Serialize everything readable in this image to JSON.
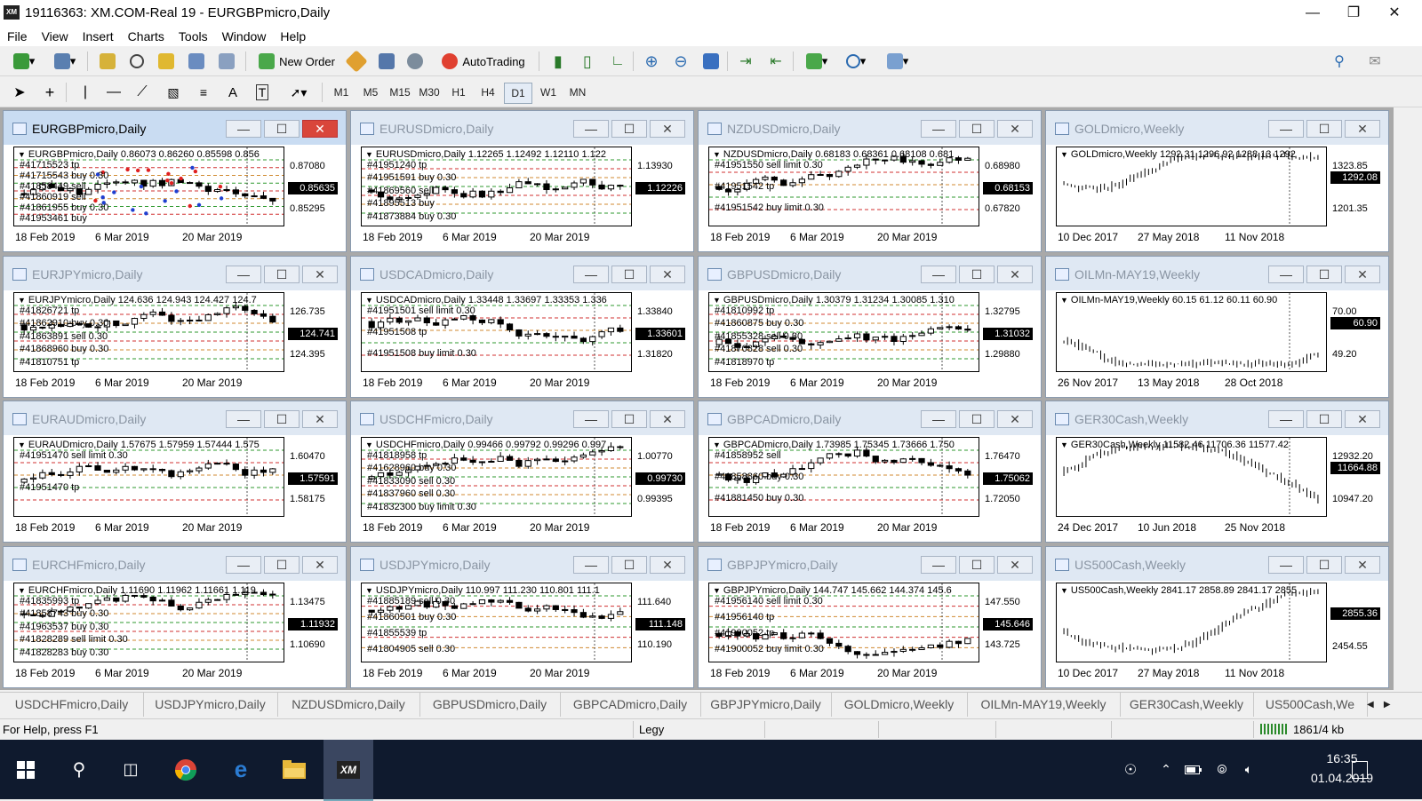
{
  "window": {
    "logo_text": "XM",
    "title": "19116363: XM.COM-Real 19 - EURGBPmicro,Daily",
    "minimize": "—",
    "maximize": "❐",
    "close": "✕"
  },
  "menu": [
    "File",
    "View",
    "Insert",
    "Charts",
    "Tools",
    "Window",
    "Help"
  ],
  "toolbar": {
    "new_order": "New Order",
    "autotrading": "AutoTrading"
  },
  "drawing_tools": {
    "text_tool": "A",
    "text_label_tool": "T"
  },
  "timeframes": [
    "M1",
    "M5",
    "M15",
    "M30",
    "H1",
    "H4",
    "D1",
    "W1",
    "MN"
  ],
  "active_timeframe": "D1",
  "charts": [
    {
      "title": "EURGBPmicro,Daily",
      "header": "EURGBPmicro,Daily  0.86073 0.86260 0.85598 0.856",
      "orders": [
        "#41715523 tp",
        "#41715543 buy 0.30",
        "#41858449 sell",
        "#41860919 sell",
        "#41861955 buy 0.30",
        "#41953461 buy"
      ],
      "yticks": [
        "0.87080",
        "0.85295"
      ],
      "price": "0.85635",
      "xticks": [
        "18 Feb 2019",
        "6 Mar 2019",
        "20 Mar 2019"
      ],
      "active": true
    },
    {
      "title": "EURUSDmicro,Daily",
      "header": "EURUSDmicro,Daily  1.12265 1.12492 1.12110 1.122",
      "orders": [
        "#41951240 tp",
        "#41951591 buy 0.30",
        "#41869560 sell",
        "#41895513 buy",
        "#41873884 buy 0.30"
      ],
      "yticks": [
        "1.13930"
      ],
      "price": "1.12226",
      "xticks": [
        "18 Feb 2019",
        "6 Mar 2019",
        "20 Mar 2019"
      ],
      "active": false
    },
    {
      "title": "NZDUSDmicro,Daily",
      "header": "NZDUSDmicro,Daily  0.68183 0.68361 0.68108 0.681",
      "orders": [
        "#41951550 sell limit 0.30",
        "#41951542 tp",
        "#41951542 buy limit 0.30"
      ],
      "yticks": [
        "0.68980",
        "0.67820"
      ],
      "price": "0.68153",
      "xticks": [
        "18 Feb 2019",
        "6 Mar 2019",
        "20 Mar 2019"
      ],
      "active": false
    },
    {
      "title": "GOLDmicro,Weekly",
      "header": "GOLDmicro,Weekly  1292.31 1296.92 1288.13 1292",
      "orders": [],
      "yticks": [
        "1323.85",
        "1201.35"
      ],
      "price": "1292.08",
      "xticks": [
        "10 Dec 2017",
        "27 May 2018",
        "11 Nov 2018"
      ],
      "active": false
    },
    {
      "title": "EURJPYmicro,Daily",
      "header": "EURJPYmicro,Daily  124.636 124.943 124.427 124.7",
      "orders": [
        "#41826721 tp",
        "#41862910 buy 0.30",
        "#41863891 sell 0.30",
        "#41868960 buy 0.30",
        "#41810751 tp"
      ],
      "yticks": [
        "126.735",
        "124.395"
      ],
      "price": "124.741",
      "xticks": [
        "18 Feb 2019",
        "6 Mar 2019",
        "20 Mar 2019"
      ],
      "active": false
    },
    {
      "title": "USDCADmicro,Daily",
      "header": "USDCADmicro,Daily  1.33448 1.33697 1.33353 1.336",
      "orders": [
        "#41951501 sell limit 0.30",
        "#41951508 tp",
        "#41951508 buy limit 0.30"
      ],
      "yticks": [
        "1.33840",
        "1.31820"
      ],
      "price": "1.33601",
      "xticks": [
        "18 Feb 2019",
        "6 Mar 2019",
        "20 Mar 2019"
      ],
      "active": false
    },
    {
      "title": "GBPUSDmicro,Daily",
      "header": "GBPUSDmicro,Daily  1.30379 1.31234 1.30085 1.310",
      "orders": [
        "#41810992 tp",
        "#41860875 buy 0.30",
        "#41855328 sell 0.30",
        "#41870828 sell 0.30",
        "#41818970 tp"
      ],
      "yticks": [
        "1.32795",
        "1.29880"
      ],
      "price": "1.31032",
      "xticks": [
        "18 Feb 2019",
        "6 Mar 2019",
        "20 Mar 2019"
      ],
      "active": false
    },
    {
      "title": "OILMn-MAY19,Weekly",
      "header": "OILMn-MAY19,Weekly  60.15 61.12 60.11 60.90",
      "orders": [],
      "yticks": [
        "70.00",
        "49.20"
      ],
      "price": "60.90",
      "xticks": [
        "26 Nov 2017",
        "13 May 2018",
        "28 Oct 2018"
      ],
      "active": false
    },
    {
      "title": "EURAUDmicro,Daily",
      "header": "EURAUDmicro,Daily  1.57675 1.57959 1.57444 1.575",
      "orders": [
        "#41951470 sell limit 0.30",
        "#41951470 tp"
      ],
      "yticks": [
        "1.60470",
        "1.58175"
      ],
      "price": "1.57591",
      "xticks": [
        "18 Feb 2019",
        "6 Mar 2019",
        "20 Mar 2019"
      ],
      "active": false
    },
    {
      "title": "USDCHFmicro,Daily",
      "header": "USDCHFmicro,Daily  0.99466 0.99792 0.99296 0.997",
      "orders": [
        "#41818958 tp",
        "#41628960 buy 0.30",
        "#41833090 sell 0.30",
        "#41837960 sell 0.30",
        "#41832300 buy limit 0.30"
      ],
      "yticks": [
        "1.00770",
        "0.99395"
      ],
      "price": "0.99730",
      "xticks": [
        "18 Feb 2019",
        "6 Mar 2019",
        "20 Mar 2019"
      ],
      "active": false
    },
    {
      "title": "GBPCADmicro,Daily",
      "header": "GBPCADmicro,Daily  1.73985 1.75345 1.73666 1.750",
      "orders": [
        "#41858952 sell",
        "#41858860 buy 0.30",
        "#41881450 buy 0.30"
      ],
      "yticks": [
        "1.76470",
        "1.72050"
      ],
      "price": "1.75062",
      "xticks": [
        "18 Feb 2019",
        "6 Mar 2019",
        "20 Mar 2019"
      ],
      "active": false
    },
    {
      "title": "GER30Cash,Weekly",
      "header": "GER30Cash,Weekly  11582.46 11706.36 11577.42",
      "orders": [],
      "yticks": [
        "12932.20",
        "10947.20"
      ],
      "price": "11664.88",
      "xticks": [
        "24 Dec 2017",
        "10 Jun 2018",
        "25 Nov 2018"
      ],
      "active": false
    },
    {
      "title": "EURCHFmicro,Daily",
      "header": "EURCHFmicro,Daily  1.11690 1.11962 1.11661 1.119",
      "orders": [
        "#41835993 tp",
        "#41858743 buy 0.30",
        "#41963537 buy 0.30",
        "#41828289 sell limit 0.30",
        "#41828283 buy 0.30"
      ],
      "yticks": [
        "1.13475",
        "1.10690"
      ],
      "price": "1.11932",
      "xticks": [
        "18 Feb 2019",
        "6 Mar 2019",
        "20 Mar 2019"
      ],
      "active": false
    },
    {
      "title": "USDJPYmicro,Daily",
      "header": "USDJPYmicro,Daily  110.997 111.230 110.801 111.1",
      "orders": [
        "#41885189 sell 0.30",
        "#41860501 buy 0.30",
        "#41855539 tp",
        "#41804905 sell 0.30"
      ],
      "yticks": [
        "111.640",
        "110.190"
      ],
      "price": "111.148",
      "xticks": [
        "18 Feb 2019",
        "6 Mar 2019",
        "20 Mar 2019"
      ],
      "active": false
    },
    {
      "title": "GBPJPYmicro,Daily",
      "header": "GBPJPYmicro,Daily  144.747 145.662 144.374 145.6",
      "orders": [
        "#41956140 sell limit 0.30",
        "#41956140 tp",
        "#41900052 tp",
        "#41900052 buy limit 0.30"
      ],
      "yticks": [
        "147.550",
        "143.725"
      ],
      "price": "145.646",
      "xticks": [
        "18 Feb 2019",
        "6 Mar 2019",
        "20 Mar 2019"
      ],
      "active": false
    },
    {
      "title": "US500Cash,Weekly",
      "header": "US500Cash,Weekly  2841.17 2858.89 2841.17 2855",
      "orders": [],
      "yticks": [
        "2454.55"
      ],
      "price": "2855.36",
      "xticks": [
        "10 Dec 2017",
        "27 May 2018",
        "11 Nov 2018"
      ],
      "active": false
    }
  ],
  "tabs": [
    "USDCHFmicro,Daily",
    "USDJPYmicro,Daily",
    "NZDUSDmicro,Daily",
    "GBPUSDmicro,Daily",
    "GBPCADmicro,Daily",
    "GBPJPYmicro,Daily",
    "GOLDmicro,Weekly",
    "OILMn-MAY19,Weekly",
    "GER30Cash,Weekly",
    "US500Cash,We"
  ],
  "tab_arrows": {
    "left": "◀",
    "right": "▶"
  },
  "status": {
    "help": "For Help, press F1",
    "profile": "Legy",
    "traffic": "1861/4 kb"
  },
  "taskbar": {
    "time": "16:35",
    "date": "01.04.2019",
    "xm_label": "XM"
  },
  "colors": {
    "active_close": "#d9463b",
    "bull_marker": "#1f3fd0",
    "bear_marker": "#e02020",
    "order_line_green": "#2f9a2f",
    "order_line_red": "#d03030",
    "order_line_orange": "#d08a30",
    "taskbar": "#0f1a2e"
  }
}
